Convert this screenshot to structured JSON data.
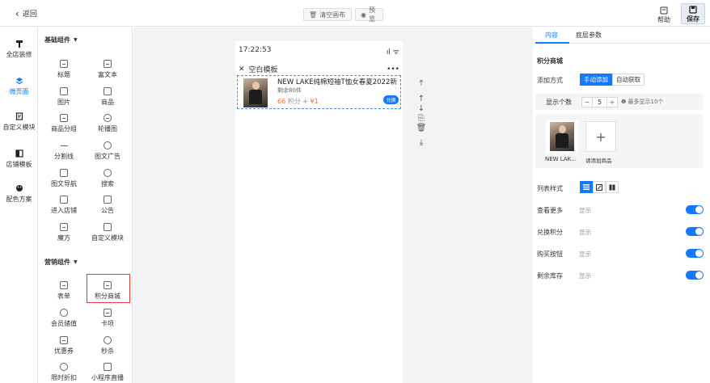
{
  "topbar": {
    "back_label": "返回",
    "clear_label": "清空画布",
    "preview_label": "预览",
    "help_label": "帮助",
    "save_label": "保存"
  },
  "left_nav": [
    {
      "label": "全店装修",
      "icon": "brush-icon",
      "active": false
    },
    {
      "label": "微页面",
      "icon": "layers-icon",
      "active": true
    },
    {
      "label": "自定义模块",
      "icon": "module-icon",
      "active": false
    },
    {
      "label": "店铺模板",
      "icon": "template-icon",
      "active": false
    },
    {
      "label": "配色方案",
      "icon": "palette-icon",
      "active": false
    }
  ],
  "palette": {
    "basic_title": "基础组件",
    "basic": [
      "标题",
      "富文本",
      "图片",
      "商品",
      "商品分组",
      "轮播图",
      "分割线",
      "图文广告",
      "图文导航",
      "搜索",
      "进入店铺",
      "公告",
      "魔方",
      "自定义模块"
    ],
    "marketing_title": "营销组件",
    "marketing": [
      "表单",
      "积分商城",
      "会员储值",
      "卡项",
      "优惠券",
      "秒杀",
      "限时折扣",
      "小程序直播"
    ]
  },
  "phone": {
    "time": "17:22:53",
    "page_title": "空白模板",
    "more": "•••",
    "product": {
      "title": "NEW LAKE纯棉短袖T恤女春夏2022新款...",
      "stock": "剩余80件",
      "points": "66",
      "points_unit": "积分",
      "plus": "+",
      "price": "¥1",
      "exchange_label": "兑换"
    }
  },
  "right_panel": {
    "tabs": [
      "内容",
      "底层参数"
    ],
    "section_title": "积分商城",
    "add_mode_label": "添加方式",
    "add_mode_options": [
      "手动添加",
      "自动获取"
    ],
    "display_count_label": "显示个数",
    "display_count_value": "5",
    "display_count_hint": "最多显示10个",
    "picked_item_name": "NEW LAK...",
    "add_product_label": "请添加商品",
    "list_style_label": "列表样式",
    "rows": [
      {
        "label": "查看更多",
        "value": "显示"
      },
      {
        "label": "兑换积分",
        "value": "显示"
      },
      {
        "label": "购买按钮",
        "value": "显示"
      },
      {
        "label": "剩余库存",
        "value": "显示"
      }
    ]
  }
}
